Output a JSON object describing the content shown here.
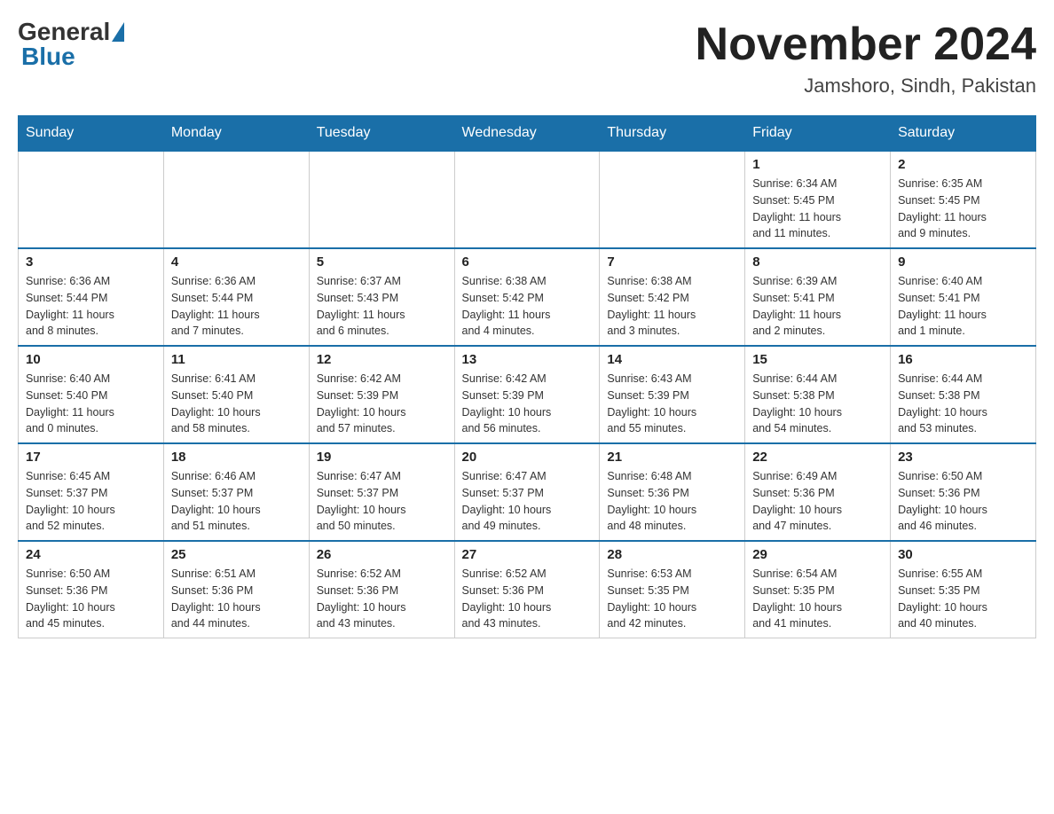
{
  "header": {
    "logo_general": "General",
    "logo_blue": "Blue",
    "title": "November 2024",
    "subtitle": "Jamshoro, Sindh, Pakistan"
  },
  "weekdays": [
    "Sunday",
    "Monday",
    "Tuesday",
    "Wednesday",
    "Thursday",
    "Friday",
    "Saturday"
  ],
  "weeks": [
    [
      {
        "day": "",
        "info": ""
      },
      {
        "day": "",
        "info": ""
      },
      {
        "day": "",
        "info": ""
      },
      {
        "day": "",
        "info": ""
      },
      {
        "day": "",
        "info": ""
      },
      {
        "day": "1",
        "info": "Sunrise: 6:34 AM\nSunset: 5:45 PM\nDaylight: 11 hours\nand 11 minutes."
      },
      {
        "day": "2",
        "info": "Sunrise: 6:35 AM\nSunset: 5:45 PM\nDaylight: 11 hours\nand 9 minutes."
      }
    ],
    [
      {
        "day": "3",
        "info": "Sunrise: 6:36 AM\nSunset: 5:44 PM\nDaylight: 11 hours\nand 8 minutes."
      },
      {
        "day": "4",
        "info": "Sunrise: 6:36 AM\nSunset: 5:44 PM\nDaylight: 11 hours\nand 7 minutes."
      },
      {
        "day": "5",
        "info": "Sunrise: 6:37 AM\nSunset: 5:43 PM\nDaylight: 11 hours\nand 6 minutes."
      },
      {
        "day": "6",
        "info": "Sunrise: 6:38 AM\nSunset: 5:42 PM\nDaylight: 11 hours\nand 4 minutes."
      },
      {
        "day": "7",
        "info": "Sunrise: 6:38 AM\nSunset: 5:42 PM\nDaylight: 11 hours\nand 3 minutes."
      },
      {
        "day": "8",
        "info": "Sunrise: 6:39 AM\nSunset: 5:41 PM\nDaylight: 11 hours\nand 2 minutes."
      },
      {
        "day": "9",
        "info": "Sunrise: 6:40 AM\nSunset: 5:41 PM\nDaylight: 11 hours\nand 1 minute."
      }
    ],
    [
      {
        "day": "10",
        "info": "Sunrise: 6:40 AM\nSunset: 5:40 PM\nDaylight: 11 hours\nand 0 minutes."
      },
      {
        "day": "11",
        "info": "Sunrise: 6:41 AM\nSunset: 5:40 PM\nDaylight: 10 hours\nand 58 minutes."
      },
      {
        "day": "12",
        "info": "Sunrise: 6:42 AM\nSunset: 5:39 PM\nDaylight: 10 hours\nand 57 minutes."
      },
      {
        "day": "13",
        "info": "Sunrise: 6:42 AM\nSunset: 5:39 PM\nDaylight: 10 hours\nand 56 minutes."
      },
      {
        "day": "14",
        "info": "Sunrise: 6:43 AM\nSunset: 5:39 PM\nDaylight: 10 hours\nand 55 minutes."
      },
      {
        "day": "15",
        "info": "Sunrise: 6:44 AM\nSunset: 5:38 PM\nDaylight: 10 hours\nand 54 minutes."
      },
      {
        "day": "16",
        "info": "Sunrise: 6:44 AM\nSunset: 5:38 PM\nDaylight: 10 hours\nand 53 minutes."
      }
    ],
    [
      {
        "day": "17",
        "info": "Sunrise: 6:45 AM\nSunset: 5:37 PM\nDaylight: 10 hours\nand 52 minutes."
      },
      {
        "day": "18",
        "info": "Sunrise: 6:46 AM\nSunset: 5:37 PM\nDaylight: 10 hours\nand 51 minutes."
      },
      {
        "day": "19",
        "info": "Sunrise: 6:47 AM\nSunset: 5:37 PM\nDaylight: 10 hours\nand 50 minutes."
      },
      {
        "day": "20",
        "info": "Sunrise: 6:47 AM\nSunset: 5:37 PM\nDaylight: 10 hours\nand 49 minutes."
      },
      {
        "day": "21",
        "info": "Sunrise: 6:48 AM\nSunset: 5:36 PM\nDaylight: 10 hours\nand 48 minutes."
      },
      {
        "day": "22",
        "info": "Sunrise: 6:49 AM\nSunset: 5:36 PM\nDaylight: 10 hours\nand 47 minutes."
      },
      {
        "day": "23",
        "info": "Sunrise: 6:50 AM\nSunset: 5:36 PM\nDaylight: 10 hours\nand 46 minutes."
      }
    ],
    [
      {
        "day": "24",
        "info": "Sunrise: 6:50 AM\nSunset: 5:36 PM\nDaylight: 10 hours\nand 45 minutes."
      },
      {
        "day": "25",
        "info": "Sunrise: 6:51 AM\nSunset: 5:36 PM\nDaylight: 10 hours\nand 44 minutes."
      },
      {
        "day": "26",
        "info": "Sunrise: 6:52 AM\nSunset: 5:36 PM\nDaylight: 10 hours\nand 43 minutes."
      },
      {
        "day": "27",
        "info": "Sunrise: 6:52 AM\nSunset: 5:36 PM\nDaylight: 10 hours\nand 43 minutes."
      },
      {
        "day": "28",
        "info": "Sunrise: 6:53 AM\nSunset: 5:35 PM\nDaylight: 10 hours\nand 42 minutes."
      },
      {
        "day": "29",
        "info": "Sunrise: 6:54 AM\nSunset: 5:35 PM\nDaylight: 10 hours\nand 41 minutes."
      },
      {
        "day": "30",
        "info": "Sunrise: 6:55 AM\nSunset: 5:35 PM\nDaylight: 10 hours\nand 40 minutes."
      }
    ]
  ]
}
